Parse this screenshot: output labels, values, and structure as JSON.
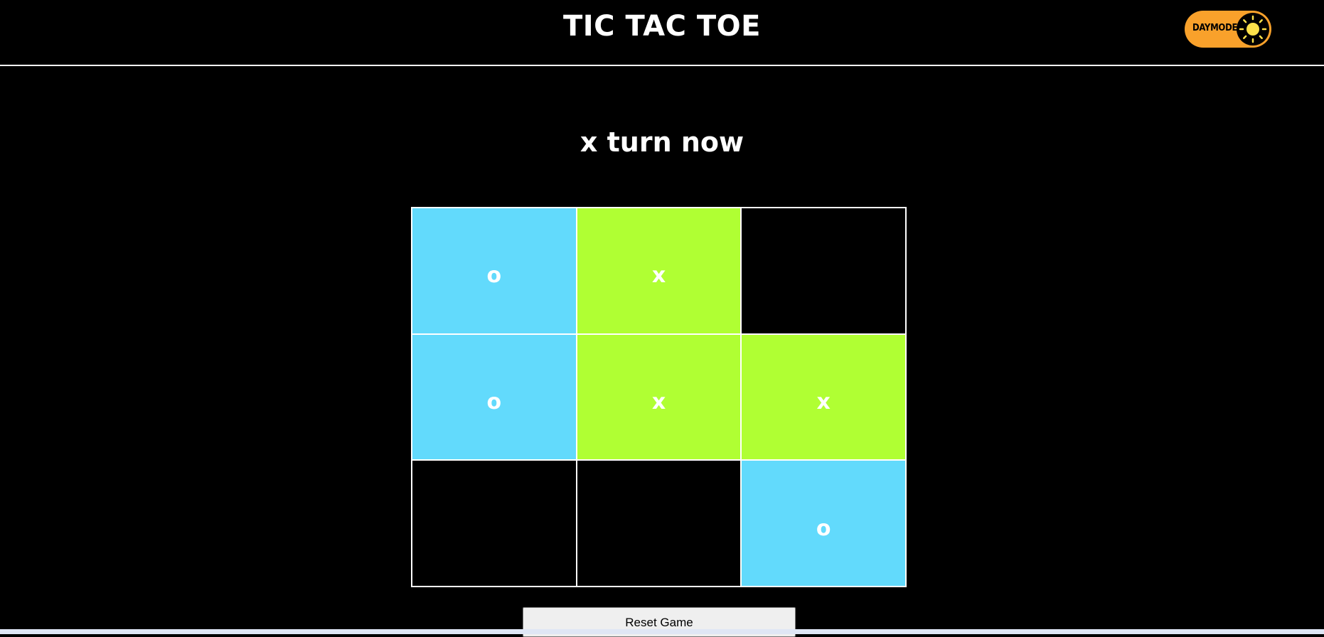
{
  "header": {
    "title": "TIC TAC TOE",
    "mode_toggle": {
      "label": "DAYMODE",
      "icon": "sun-icon",
      "color": "#f9a12b"
    }
  },
  "status": "x turn now",
  "board": {
    "colors": {
      "x": "#b0ff33",
      "o": "#62dafc",
      "empty": "#000000"
    },
    "cells": [
      "o",
      "x",
      "",
      "o",
      "x",
      "x",
      "",
      "",
      "o"
    ]
  },
  "reset_label": "Reset Game"
}
